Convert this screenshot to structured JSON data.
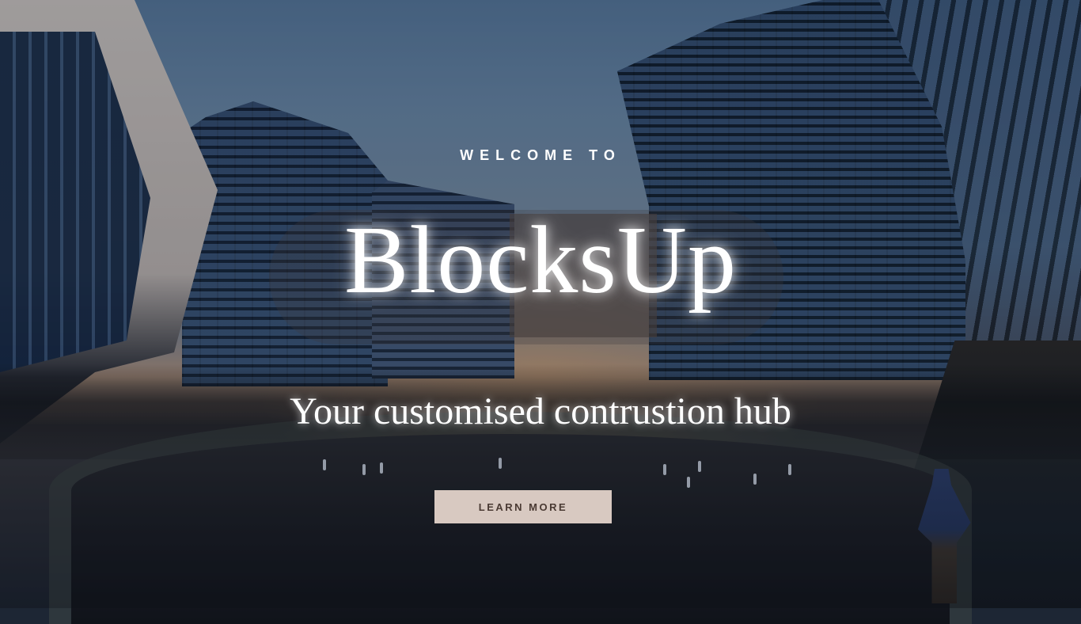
{
  "hero": {
    "eyebrow": "WELCOME TO",
    "brand": "BlocksUp",
    "tagline": "Your customised contrustion hub",
    "cta_label": "LEARN MORE"
  },
  "colors": {
    "cta_background": "#d8c9c1",
    "cta_text": "#4a3a33",
    "text": "#ffffff"
  }
}
